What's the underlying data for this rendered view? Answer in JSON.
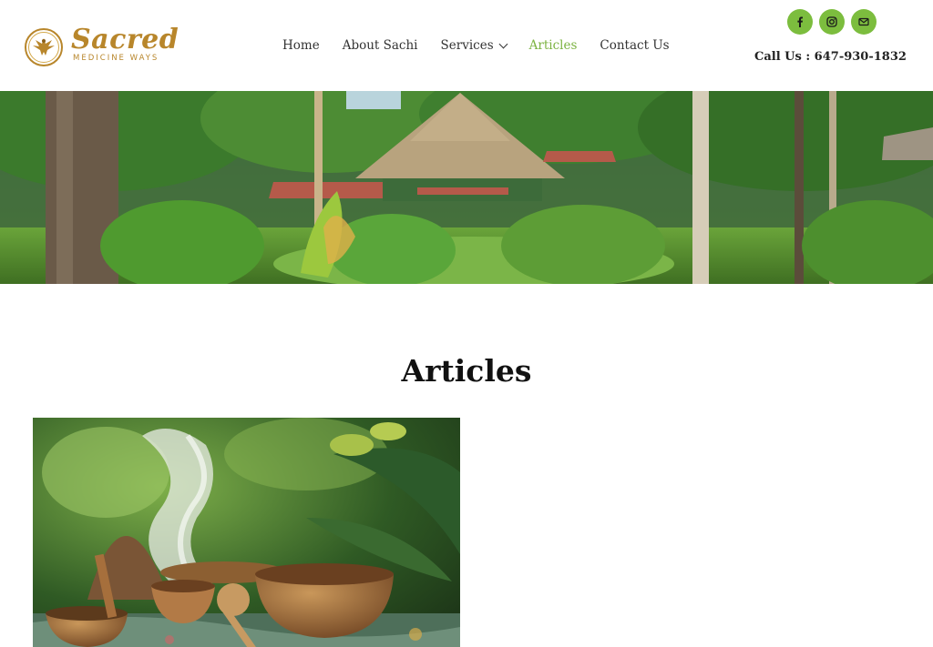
{
  "brand": {
    "script": "Sacred",
    "tagline": "MEDICINE WAYS"
  },
  "nav": {
    "items": [
      {
        "label": "Home"
      },
      {
        "label": "About Sachi"
      },
      {
        "label": "Services"
      },
      {
        "label": "Articles"
      },
      {
        "label": "Contact Us"
      }
    ]
  },
  "header": {
    "call_text": "Call Us : 647-930-1832",
    "social_icons": [
      "facebook-icon",
      "instagram-icon",
      "envelope-icon"
    ]
  },
  "page": {
    "title": "Articles"
  },
  "colors": {
    "accent": "#7cbd3e",
    "brand_gold": "#b8862b",
    "text": "#333333"
  }
}
